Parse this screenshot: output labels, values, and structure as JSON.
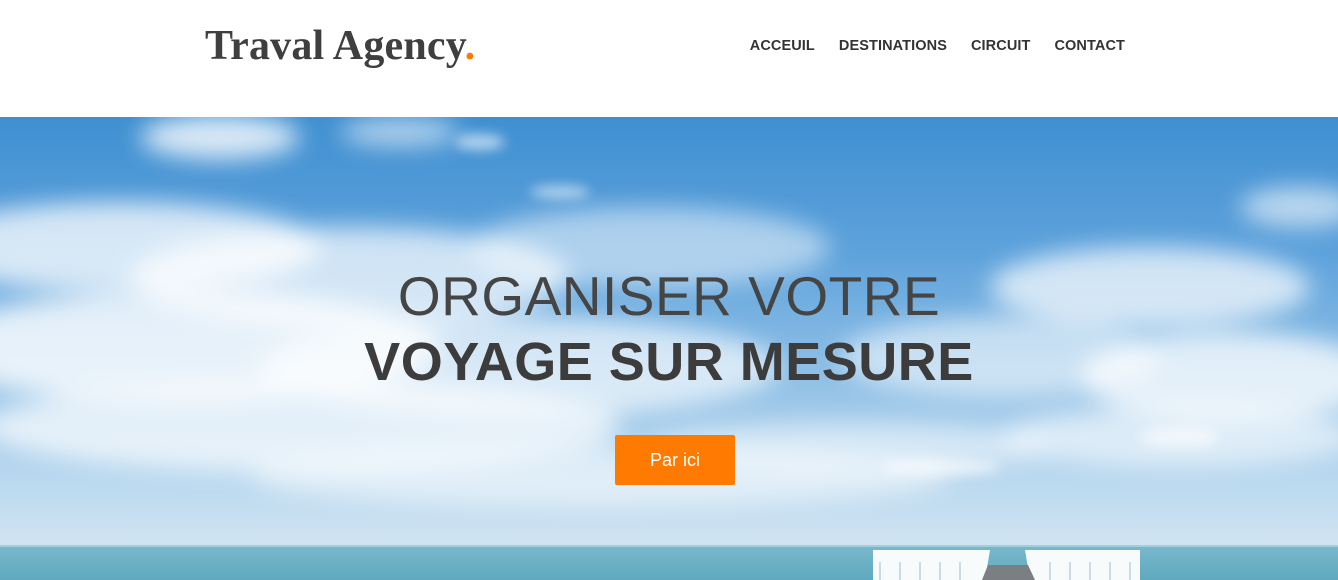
{
  "brand": {
    "name": "Traval Agency",
    "dot": "."
  },
  "nav": {
    "items": [
      {
        "label": "ACCEUIL"
      },
      {
        "label": "DESTINATIONS"
      },
      {
        "label": "CIRCUIT"
      },
      {
        "label": "CONTACT"
      }
    ]
  },
  "hero": {
    "title_line1": "ORGANISER VOTRE",
    "title_line2": "VOYAGE SUR MESURE",
    "cta_label": "Par ici"
  },
  "colors": {
    "accent": "#ff7a00",
    "text_dark": "#3f3f3f",
    "sky_top": "#3f8fd1",
    "sea": "#7fc1cf"
  }
}
